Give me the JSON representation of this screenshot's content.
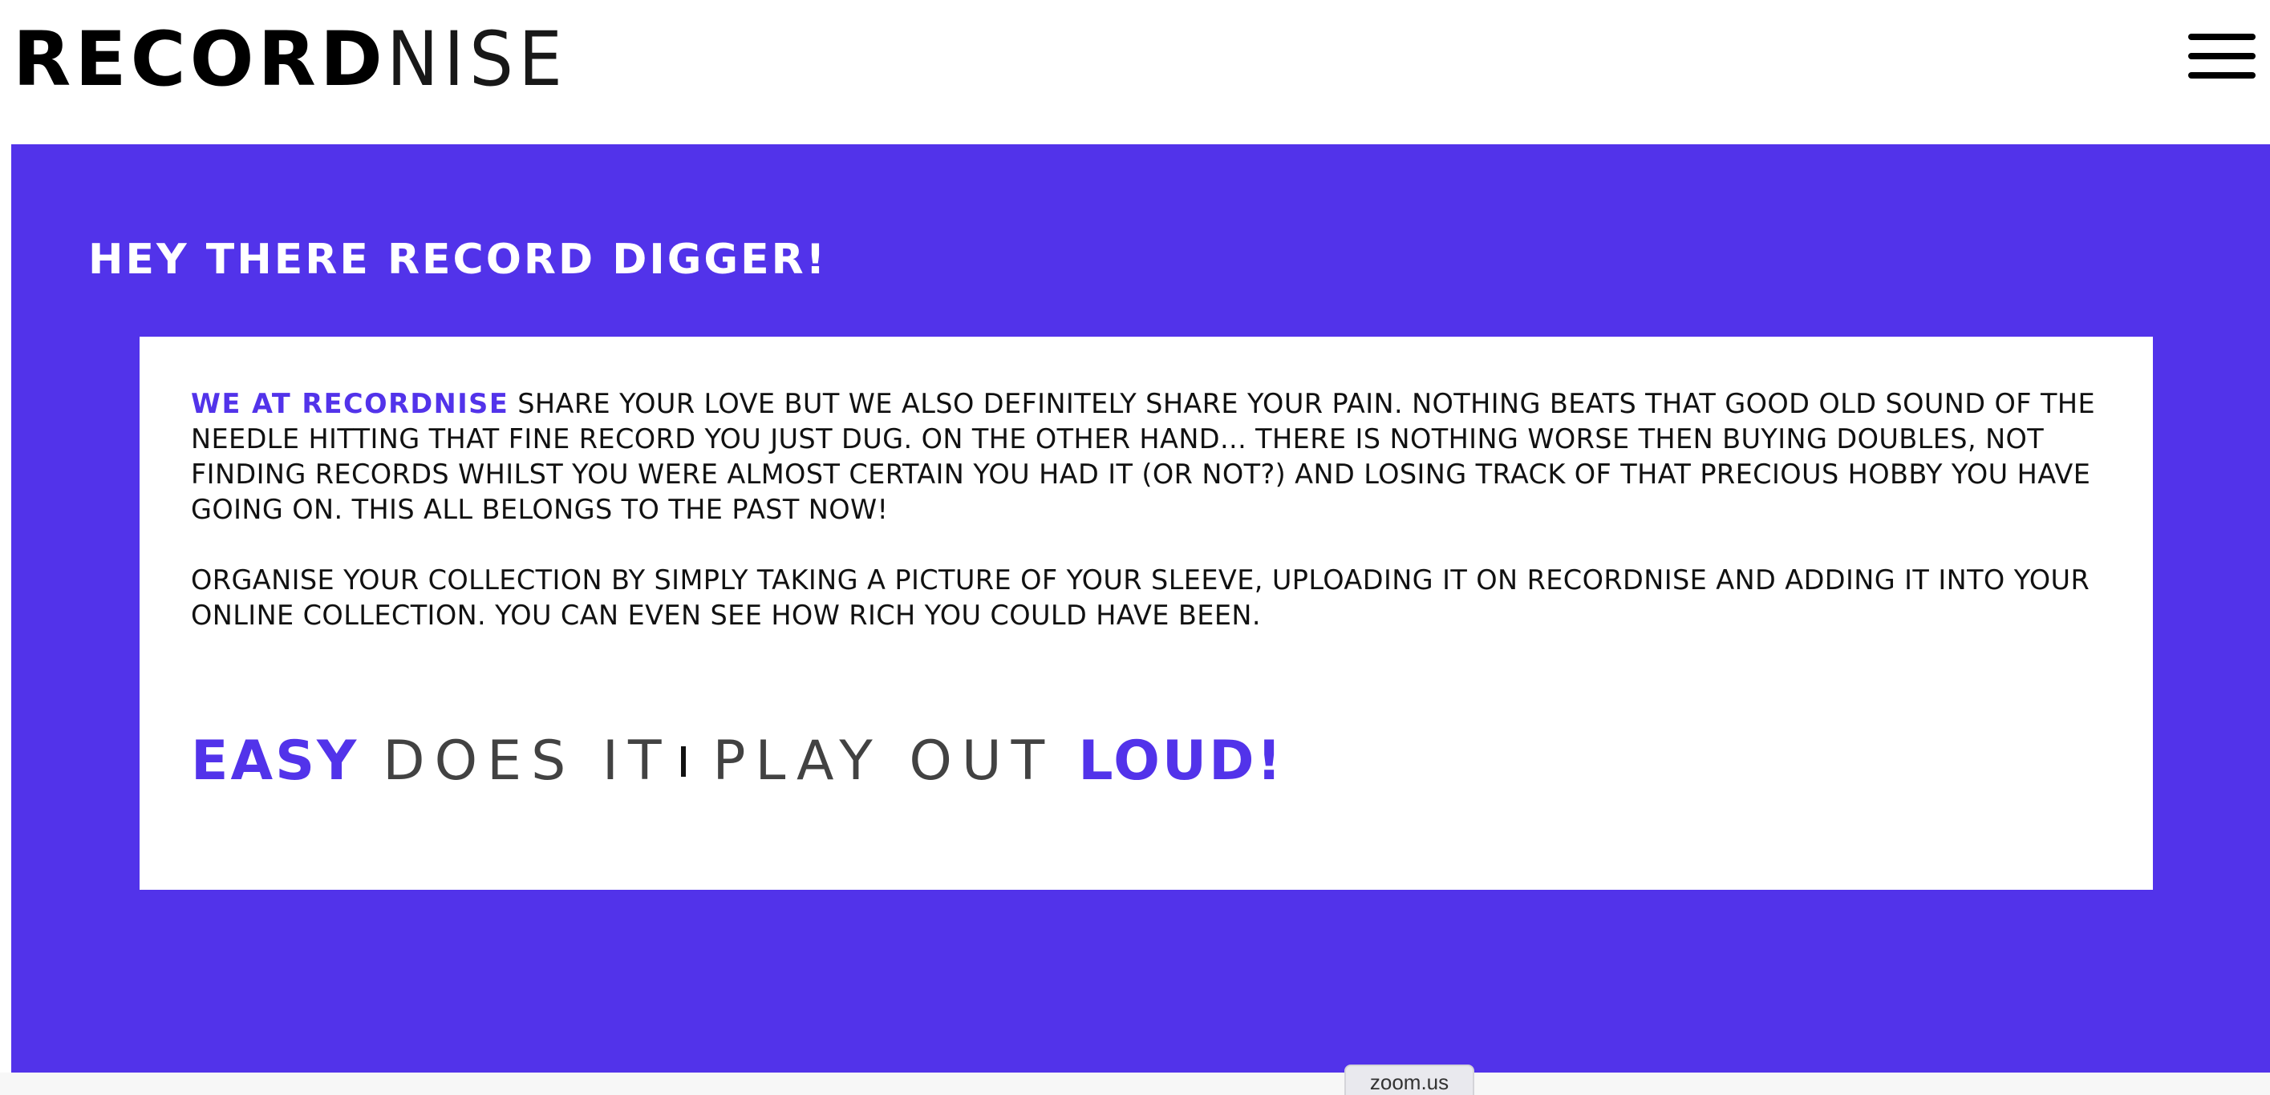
{
  "header": {
    "logo_bold": "RECORD",
    "logo_light": "NISE",
    "menu_icon": "hamburger-menu-icon"
  },
  "hero": {
    "heading": "HEY THERE RECORD DIGGER!",
    "background_color": "#5233ea"
  },
  "card": {
    "lead": "WE AT RECORDNISE",
    "paragraph1_rest": " SHARE YOUR LOVE BUT WE ALSO DEFINITELY SHARE YOUR PAIN. NOTHING BEATS THAT GOOD OLD SOUND OF THE NEEDLE HITTING THAT FINE RECORD YOU JUST DUG. ON THE OTHER HAND... THERE IS NOTHING WORSE THEN BUYING DOUBLES, NOT FINDING RECORDS WHILST YOU WERE ALMOST CERTAIN YOU HAD IT (OR NOT?) AND LOSING TRACK OF THAT PRECIOUS HOBBY YOU HAVE GOING ON. THIS ALL BELONGS TO THE PAST NOW!",
    "paragraph2": "ORGANISE YOUR COLLECTION BY SIMPLY TAKING A PICTURE OF YOUR SLEEVE, UPLOADING IT ON RECORDNISE AND ADDING IT INTO YOUR ONLINE COLLECTION. YOU CAN EVEN SEE HOW RICH YOU COULD HAVE BEEN."
  },
  "tagline": {
    "word1_bold": "EASY",
    "word1_light": "DOES IT",
    "separator": "|",
    "word2_light": "PLAY OUT",
    "word2_bold": "LOUD!"
  },
  "bottom_bar": {
    "tab_label": "zoom.us"
  },
  "colors": {
    "accent": "#5233ea",
    "text": "#111111",
    "background": "#ffffff"
  }
}
